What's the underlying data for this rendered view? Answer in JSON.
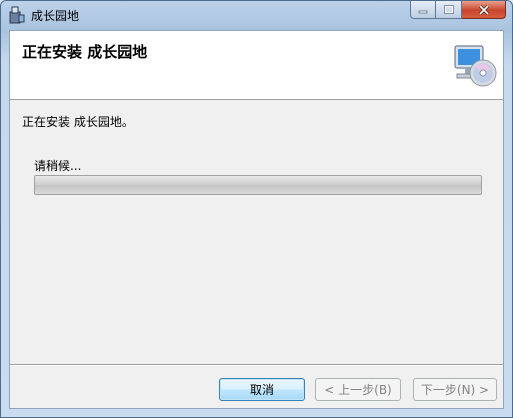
{
  "window": {
    "title": "成长园地"
  },
  "header": {
    "title": "正在安装 成长园地"
  },
  "body": {
    "status": "正在安装 成长园地。",
    "wait_label": "请稍候...",
    "progress": 0
  },
  "buttons": {
    "cancel": "取消",
    "back": "< 上一步(B)",
    "next": "下一步(N) >"
  },
  "colors": {
    "accent": "#3c7fb1",
    "close": "#c8452c"
  },
  "icons": [
    "installer-icon",
    "minimize-icon",
    "maximize-icon",
    "close-icon",
    "computer-cd-icon"
  ]
}
